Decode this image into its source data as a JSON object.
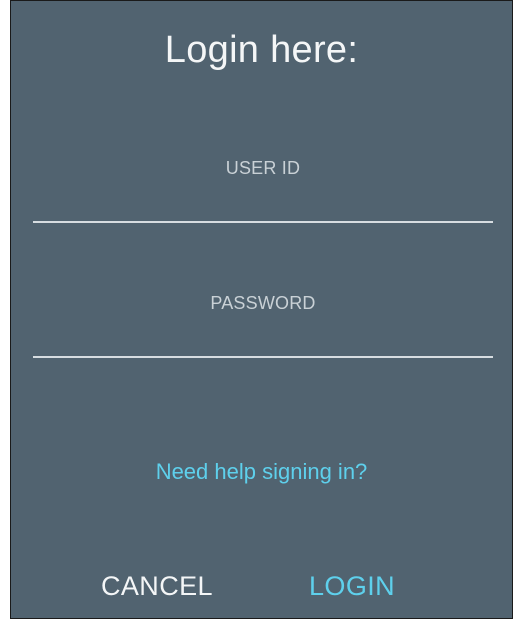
{
  "dialog": {
    "title": "Login here:",
    "user_id": {
      "label": "USER ID",
      "value": "",
      "placeholder": ""
    },
    "password": {
      "label": "PASSWORD",
      "value": "",
      "placeholder": ""
    },
    "help_link": "Need help signing in?",
    "cancel_label": "CANCEL",
    "login_label": "LOGIN"
  },
  "colors": {
    "background": "#516370",
    "accent": "#5ed0ec",
    "text": "#f4f6f7",
    "field_label": "#c9d1d6",
    "underline": "#d7dde1"
  }
}
